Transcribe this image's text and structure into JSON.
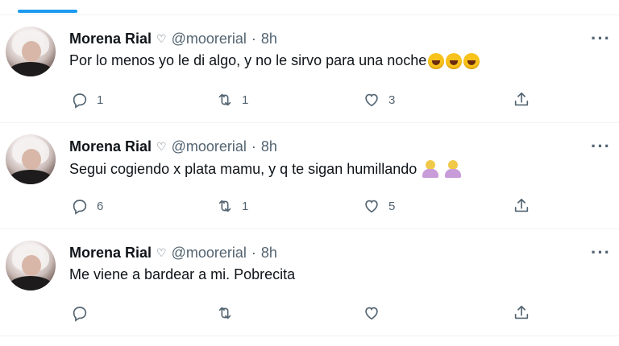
{
  "colors": {
    "accent": "#1d9bf0",
    "text": "#0f1419",
    "secondary": "#536471",
    "divider": "#eff3f4"
  },
  "icons": {
    "reply": "reply-icon",
    "retweet": "retweet-icon",
    "like": "like-icon",
    "share": "share-icon",
    "more": "more-icon"
  },
  "tweets": [
    {
      "name": "Morena Rial",
      "handle": "@moorerial",
      "dot": "·",
      "time": "8h",
      "more": "···",
      "text": "Por lo menos yo le di algo, y no le sirvo para una noche",
      "emoji": [
        "rolling-on-floor-laughing",
        "rolling-on-floor-laughing",
        "rolling-on-floor-laughing"
      ],
      "replies": "1",
      "retweets": "1",
      "likes": "3"
    },
    {
      "name": "Morena Rial",
      "handle": "@moorerial",
      "dot": "·",
      "time": "8h",
      "more": "···",
      "text": "Segui cogiendo x plata mamu, y q te sigan humillando",
      "emoji": [
        "person-shrugging",
        "person-shrugging"
      ],
      "replies": "6",
      "retweets": "1",
      "likes": "5"
    },
    {
      "name": "Morena Rial",
      "handle": "@moorerial",
      "dot": "·",
      "time": "8h",
      "more": "···",
      "text": "Me viene a bardear a mi. Pobrecita",
      "emoji": [],
      "replies": "",
      "retweets": "",
      "likes": ""
    }
  ]
}
